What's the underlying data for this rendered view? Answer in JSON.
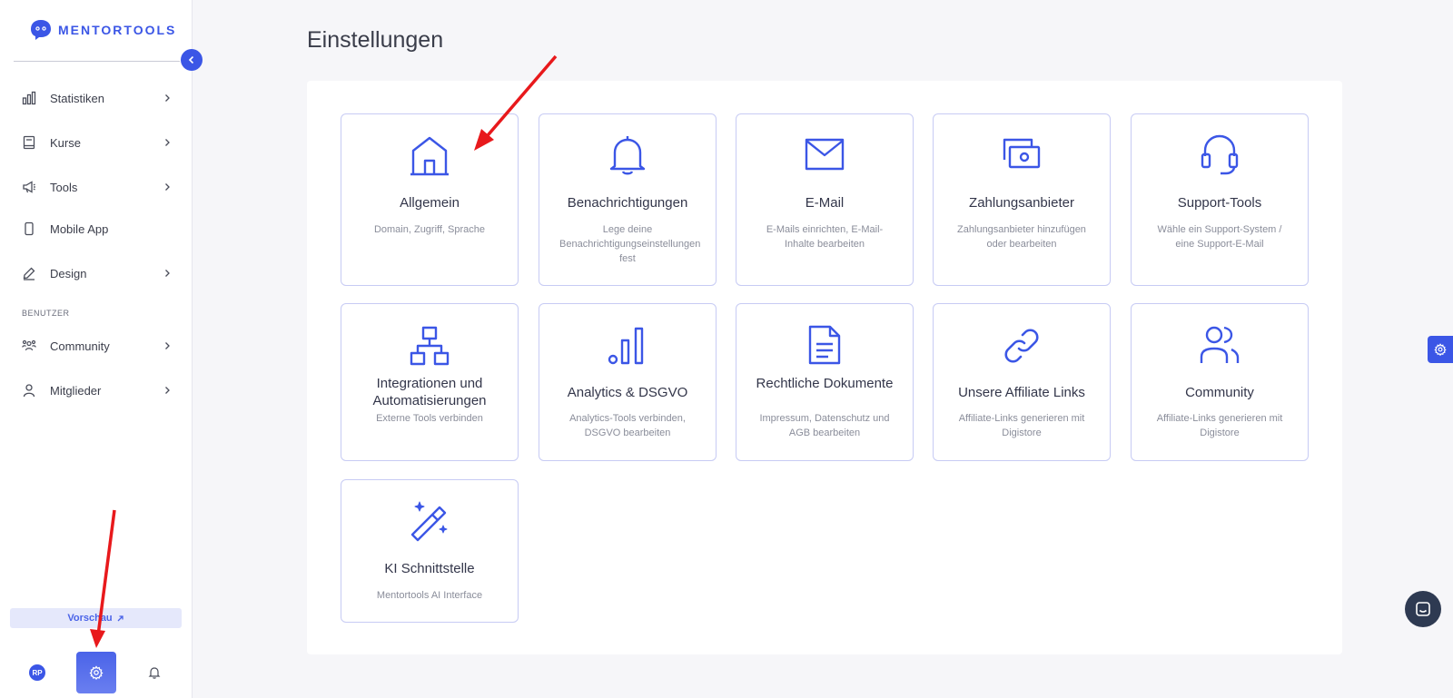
{
  "brand": {
    "name": "MENTORTOOLS",
    "accent": "#3b56e6"
  },
  "sidebar": {
    "items": [
      {
        "label": "Statistiken",
        "icon": "bar-chart-icon",
        "has_chevron": true
      },
      {
        "label": "Kurse",
        "icon": "book-icon",
        "has_chevron": true
      },
      {
        "label": "Tools",
        "icon": "megaphone-icon",
        "has_chevron": true
      },
      {
        "label": "Mobile App",
        "icon": "phone-icon",
        "has_chevron": false
      },
      {
        "label": "Design",
        "icon": "pencil-icon",
        "has_chevron": true
      }
    ],
    "section_label": "BENUTZER",
    "user_items": [
      {
        "label": "Community",
        "icon": "users-icon",
        "has_chevron": true
      },
      {
        "label": "Mitglieder",
        "icon": "user-icon",
        "has_chevron": true
      }
    ],
    "preview_label": "Vorschau",
    "avatar_initials": "RP"
  },
  "page": {
    "title": "Einstellungen"
  },
  "cards": [
    {
      "title": "Allgemein",
      "description": "Domain, Zugriff, Sprache",
      "icon": "house-icon"
    },
    {
      "title": "Benachrichtigungen",
      "description": "Lege deine Benachrichtigungseinstellungen fest",
      "icon": "bell-icon"
    },
    {
      "title": "E-Mail",
      "description": "E-Mails einrichten, E-Mail-Inhalte bearbeiten",
      "icon": "mail-icon"
    },
    {
      "title": "Zahlungsanbieter",
      "description": "Zahlungsanbieter hinzufügen oder bearbeiten",
      "icon": "money-icon"
    },
    {
      "title": "Support-Tools",
      "description": "Wähle ein Support-System / eine Support-E-Mail",
      "icon": "headset-icon"
    },
    {
      "title": "Integrationen und Automatisierungen",
      "description": "Externe Tools verbinden",
      "icon": "sitemap-icon"
    },
    {
      "title": "Analytics & DSGVO",
      "description": "Analytics-Tools verbinden, DSGVO bearbeiten",
      "icon": "analytics-icon"
    },
    {
      "title": "Rechtliche Dokumente",
      "description": "Impressum, Datenschutz und AGB bearbeiten",
      "icon": "document-icon"
    },
    {
      "title": "Unsere Affiliate Links",
      "description": "Affiliate-Links generieren mit Digistore",
      "icon": "link-icon"
    },
    {
      "title": "Community",
      "description": "Affiliate-Links generieren mit Digistore",
      "icon": "users-icon"
    },
    {
      "title": "KI Schnittstelle",
      "description": "Mentortools AI Interface",
      "icon": "magic-wand-icon"
    }
  ]
}
